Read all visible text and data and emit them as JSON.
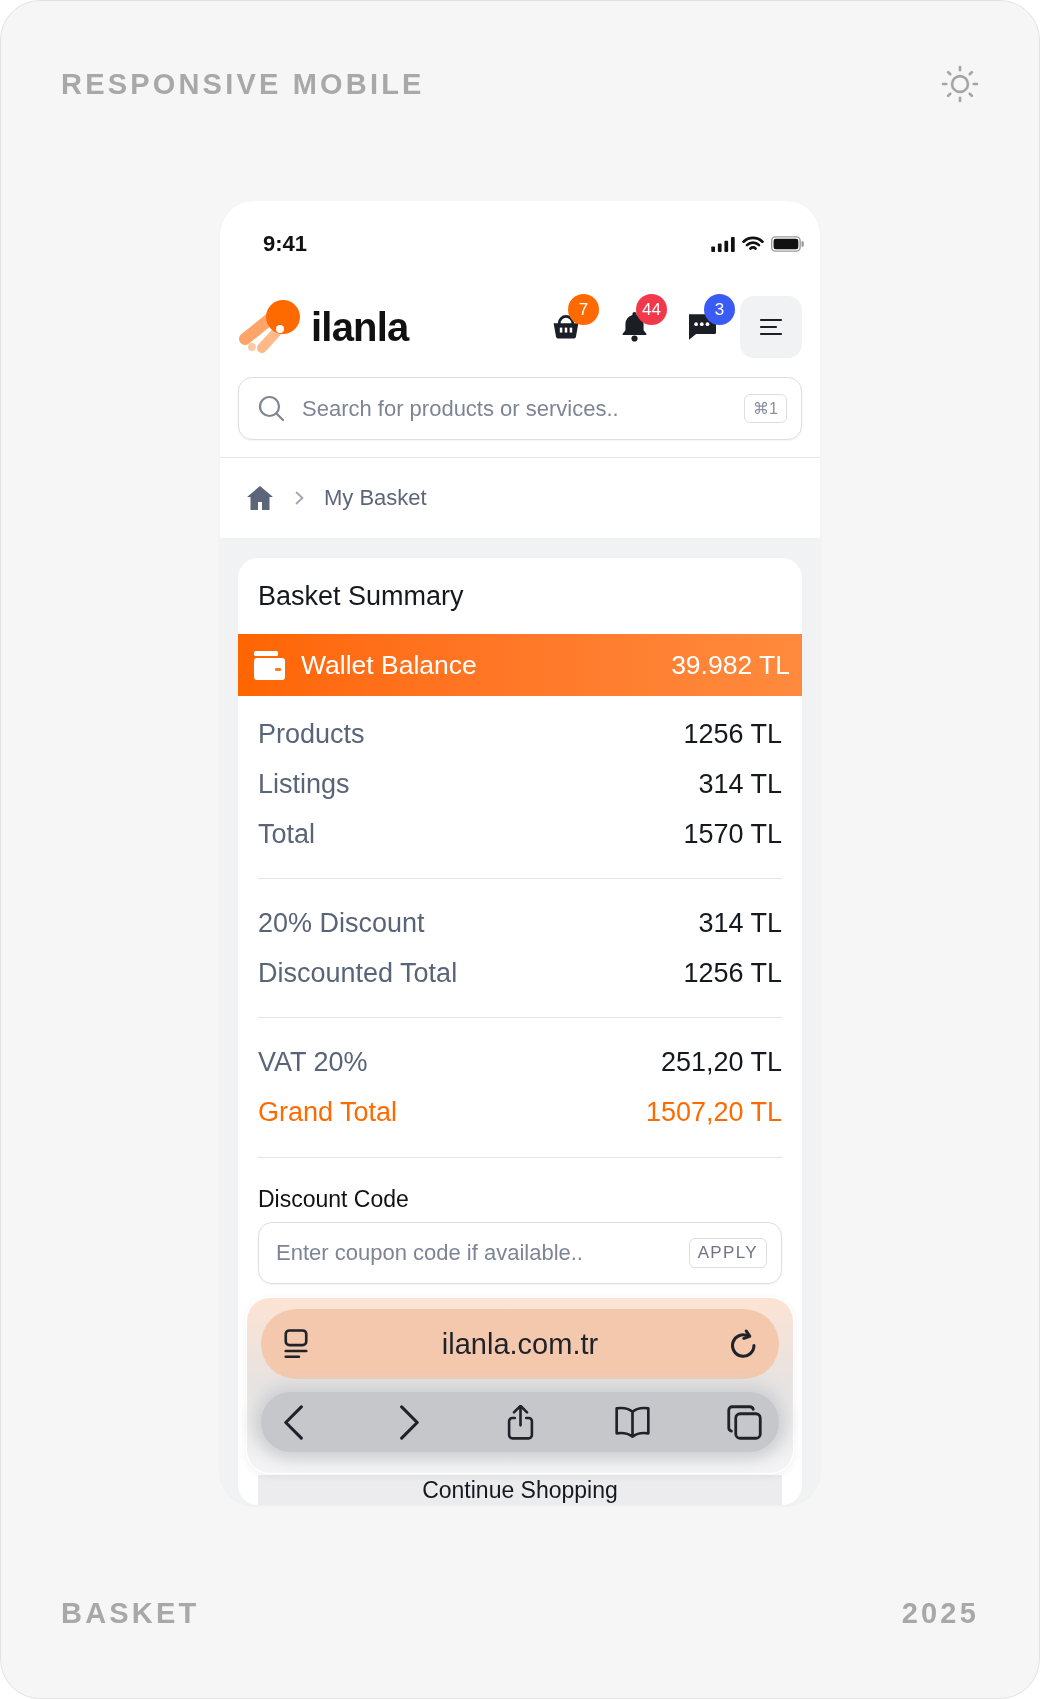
{
  "frame": {
    "title": "RESPONSIVE MOBILE",
    "footer_label": "BASKET",
    "year": "2025"
  },
  "status_bar": {
    "time": "9:41"
  },
  "header": {
    "logo_text": "ilanla",
    "actions": [
      {
        "kind": "basket",
        "badge": "7",
        "color": "#ff6a00"
      },
      {
        "kind": "bell",
        "badge": "44",
        "color": "#f2394b"
      },
      {
        "kind": "chat",
        "badge": "3",
        "color": "#3a5cf5"
      }
    ]
  },
  "search": {
    "placeholder": "Search for products or services..",
    "shortcut": "⌘1"
  },
  "breadcrumb": {
    "current": "My Basket"
  },
  "summary": {
    "title": "Basket Summary",
    "wallet": {
      "label": "Wallet Balance",
      "value": "39.982 TL"
    },
    "groups": [
      {
        "rows": [
          {
            "label": "Products",
            "value": "1256 TL",
            "highlight": false
          },
          {
            "label": "Listings",
            "value": "314 TL",
            "highlight": false
          },
          {
            "label": "Total",
            "value": "1570 TL",
            "highlight": false
          }
        ]
      },
      {
        "rows": [
          {
            "label": "20% Discount",
            "value": "314 TL",
            "highlight": false
          },
          {
            "label": "Discounted Total",
            "value": "1256 TL",
            "highlight": false
          }
        ]
      },
      {
        "rows": [
          {
            "label": "VAT 20%",
            "value": "251,20 TL",
            "highlight": false
          },
          {
            "label": "Grand Total",
            "value": "1507,20 TL",
            "highlight": true
          }
        ]
      }
    ]
  },
  "discount_code": {
    "label": "Discount Code",
    "placeholder": "Enter coupon code if available..",
    "button": "APPLY"
  },
  "browser_bar": {
    "url": "ilanla.com.tr"
  },
  "continue_button": "Continue Shopping"
}
